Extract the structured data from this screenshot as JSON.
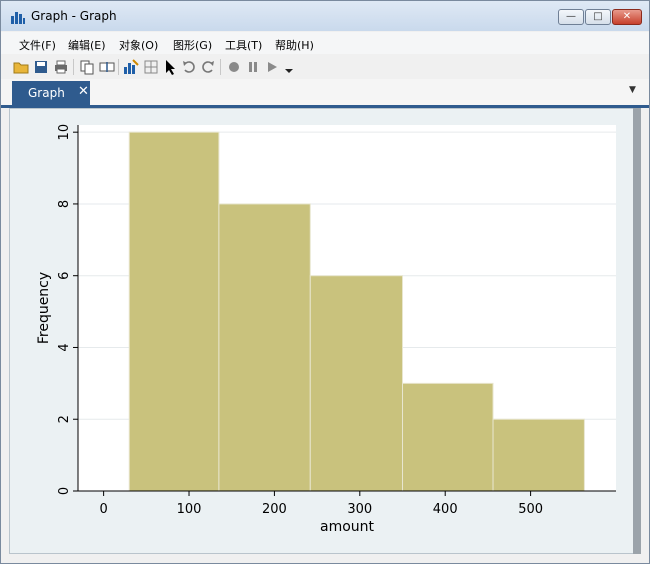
{
  "window": {
    "title": "Graph - Graph",
    "close_glyph": "✕",
    "max_glyph": "□",
    "min_glyph": "—"
  },
  "menu": [
    "文件(F)",
    "编辑(E)",
    "对象(O)",
    "图形(G)",
    "工具(T)",
    "帮助(H)"
  ],
  "toolbar": {
    "icons": [
      "open-folder-icon",
      "save-icon",
      "print-icon",
      "copy-icon",
      "rename-icon",
      "graph-editor-icon",
      "grid-icon",
      "pointer-icon",
      "undo-icon",
      "redo-icon",
      "record-icon",
      "pause-icon",
      "play-icon"
    ]
  },
  "tabs": [
    {
      "label": "Graph",
      "close": "✕"
    }
  ],
  "colors": {
    "bar_fill": "#c9c27d",
    "bar_stroke": "#e8e6cf",
    "plot_bg": "#ffffff",
    "outer_bg": "#ebf1f3",
    "tab_bg": "#2f5b8e"
  },
  "chart_data": {
    "type": "bar",
    "title": "",
    "xlabel": "amount",
    "ylabel": "Frequency",
    "bins": [
      {
        "start": 30,
        "end": 135,
        "value": 10
      },
      {
        "start": 135,
        "end": 242,
        "value": 8
      },
      {
        "start": 242,
        "end": 350,
        "value": 6
      },
      {
        "start": 350,
        "end": 456,
        "value": 3
      },
      {
        "start": 456,
        "end": 563,
        "value": 2
      }
    ],
    "xlim": [
      -30,
      600
    ],
    "ylim": [
      0,
      10.2
    ],
    "xticks": [
      0,
      100,
      200,
      300,
      400,
      500
    ],
    "yticks": [
      0,
      2,
      4,
      6,
      8,
      10
    ],
    "grid": true
  }
}
